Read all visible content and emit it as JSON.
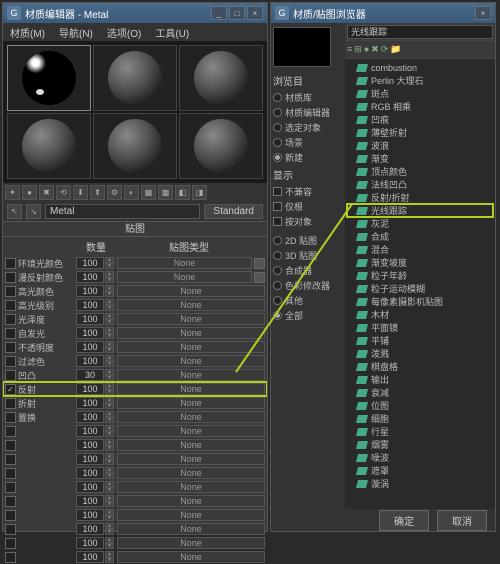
{
  "left": {
    "title": "材质编辑器 - Metal",
    "menus": [
      "材质(M)",
      "导航(N)",
      "选项(O)",
      "工具(U)"
    ],
    "material_name": "Metal",
    "material_type": "Standard",
    "section_title": "贴图",
    "col_qty": "数量",
    "col_type": "贴图类型",
    "rows": [
      {
        "cb": false,
        "name": "环境光颜色",
        "num": "100",
        "type": "None",
        "swatch": true
      },
      {
        "cb": false,
        "name": "漫反射颜色",
        "num": "100",
        "type": "None",
        "swatch": true
      },
      {
        "cb": false,
        "name": "高光颜色",
        "num": "100",
        "type": "None",
        "swatch": false
      },
      {
        "cb": false,
        "name": "高光级别",
        "num": "100",
        "type": "None",
        "swatch": false
      },
      {
        "cb": false,
        "name": "光泽度",
        "num": "100",
        "type": "None",
        "swatch": false
      },
      {
        "cb": false,
        "name": "自发光",
        "num": "100",
        "type": "None",
        "swatch": false
      },
      {
        "cb": false,
        "name": "不透明度",
        "num": "100",
        "type": "None",
        "swatch": false
      },
      {
        "cb": false,
        "name": "过滤色",
        "num": "100",
        "type": "None",
        "swatch": false
      },
      {
        "cb": false,
        "name": "凹凸",
        "num": "30",
        "type": "None",
        "swatch": false
      },
      {
        "cb": true,
        "name": "反射",
        "num": "100",
        "type": "None",
        "swatch": false,
        "hl": true
      },
      {
        "cb": false,
        "name": "折射",
        "num": "100",
        "type": "None",
        "swatch": false
      },
      {
        "cb": false,
        "name": "置换",
        "num": "100",
        "type": "None",
        "swatch": false
      },
      {
        "cb": false,
        "name": "",
        "num": "100",
        "type": "None",
        "swatch": false
      },
      {
        "cb": false,
        "name": "",
        "num": "100",
        "type": "None",
        "swatch": false
      },
      {
        "cb": false,
        "name": "",
        "num": "100",
        "type": "None",
        "swatch": false
      },
      {
        "cb": false,
        "name": "",
        "num": "100",
        "type": "None",
        "swatch": false
      },
      {
        "cb": false,
        "name": "",
        "num": "100",
        "type": "None",
        "swatch": false
      },
      {
        "cb": false,
        "name": "",
        "num": "100",
        "type": "None",
        "swatch": false
      },
      {
        "cb": false,
        "name": "",
        "num": "100",
        "type": "None",
        "swatch": false
      },
      {
        "cb": false,
        "name": "",
        "num": "100",
        "type": "None",
        "swatch": false
      },
      {
        "cb": false,
        "name": "",
        "num": "100",
        "type": "None",
        "swatch": false
      },
      {
        "cb": false,
        "name": "",
        "num": "100",
        "type": "None",
        "swatch": false
      }
    ]
  },
  "right": {
    "title": "材质/贴图浏览器",
    "search_value": "光线跟踪",
    "sidebar": {
      "browse_label": "浏览目",
      "browse_opts": [
        "材质库",
        "材质编辑器",
        "选定对象",
        "场景",
        "新建"
      ],
      "browse_selected": 4,
      "show_label": "显示",
      "show_opts": [
        "不兼容",
        "仅根",
        "按对象"
      ],
      "type_opts": [
        "2D 贴图",
        "3D 贴图",
        "合成器",
        "色彩修改器",
        "其他",
        "全部"
      ],
      "type_selected": 5
    },
    "tree": [
      "combustion",
      "Perlin 大理石",
      "斑点",
      "RGB 相乘",
      "凹痕",
      "薄壁折射",
      "波浪",
      "渐变",
      "顶点颜色",
      "法线凹凸",
      "反射/折射",
      {
        "label": "光线跟踪",
        "hl": true
      },
      "灰泥",
      "合成",
      "混合",
      "渐变坡度",
      "粒子年龄",
      "粒子运动模糊",
      "每像素摄影机贴图",
      "木材",
      "平面镜",
      "平铺",
      "泼溅",
      "棋盘格",
      "输出",
      "衰减",
      "位图",
      "细胞",
      "行星",
      "烟雾",
      "噪波",
      "遮罩",
      "漩涡"
    ],
    "footer": {
      "ok": "确定",
      "cancel": "取消"
    }
  }
}
